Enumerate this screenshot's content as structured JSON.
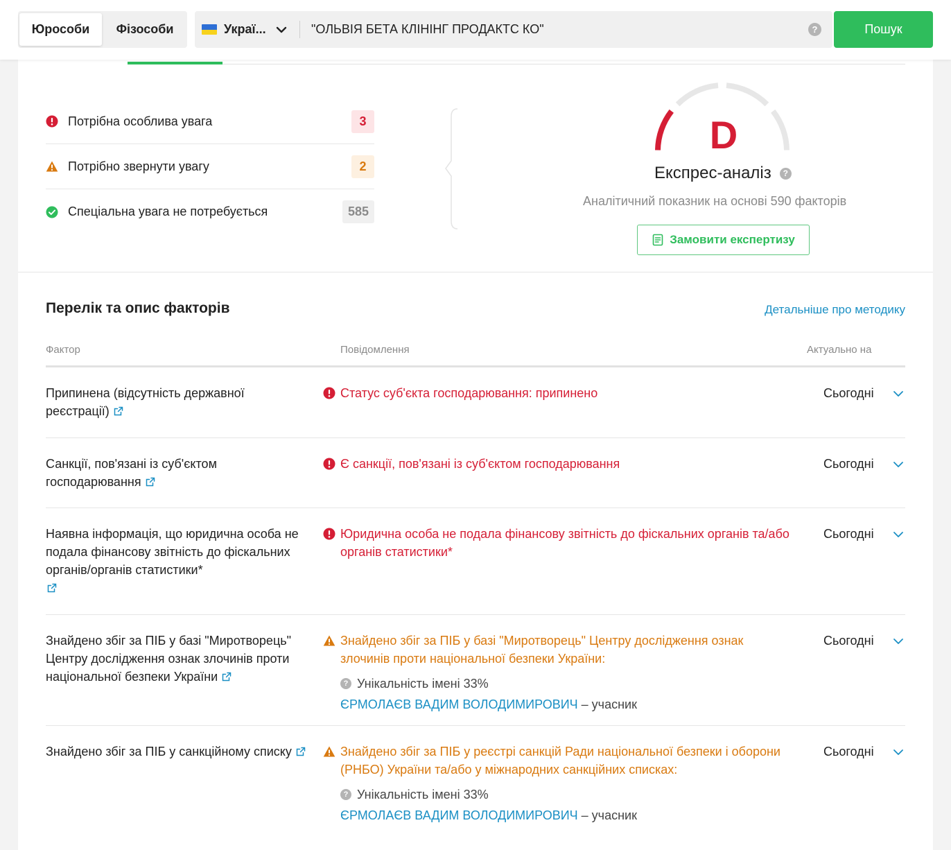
{
  "topbar": {
    "tabs": [
      "Юрособи",
      "Фізособи"
    ],
    "country": "Украї...",
    "query": "\"ОЛЬВІЯ БЕТА КЛІНІНГ ПРОДАКТС КО\"",
    "help": "?",
    "search_label": "Пошук"
  },
  "summary": {
    "items": [
      {
        "label": "Потрібна особлива увага",
        "count": "3",
        "status": "critical"
      },
      {
        "label": "Потрібно звернути увагу",
        "count": "2",
        "status": "warning"
      },
      {
        "label": "Спеціальна увага не потребується",
        "count": "585",
        "status": "ok"
      }
    ]
  },
  "express": {
    "grade": "D",
    "title": "Експрес-аналіз",
    "help": "?",
    "subtitle": "Аналітичний показник на основі 590 факторів",
    "order_label": "Замовити експертизу"
  },
  "factors": {
    "title": "Перелік та опис факторів",
    "method_link": "Детальніше про методику",
    "columns": [
      "Фактор",
      "Повідомлення",
      "Актуально на"
    ],
    "rows": [
      {
        "factor": "Припинена (відсутність державної реєстрації)",
        "message": "Статус суб'єкта господарювання: припинено",
        "severity": "critical",
        "date": "Сьогодні"
      },
      {
        "factor": "Санкції, пов'язані із суб'єктом господарювання",
        "message": "Є санкції, пов'язані із суб'єктом господарювання",
        "severity": "critical",
        "date": "Сьогодні"
      },
      {
        "factor": "Наявна інформація, що юридична особа не подала фінансову звітність до фіскальних органів/органів статистики*",
        "message": "Юридична особа не подала фінансову звітність до фіскальних органів та/або органів статистики*",
        "severity": "critical",
        "date": "Сьогодні"
      },
      {
        "factor": "Знайдено збіг за ПІБ у базі \"Миротворець\" Центру дослідження ознак злочинів проти національної безпеки України",
        "message": "Знайдено збіг за ПІБ у базі \"Миротворець\" Центру дослідження ознак злочинів проти національної безпеки України:",
        "severity": "warning",
        "uniqueness": "Унікальність імені 33%",
        "person": "ЄРМОЛАЄВ ВАДИМ ВОЛОДИМИРОВИЧ",
        "role": " – учасник",
        "date": "Сьогодні"
      },
      {
        "factor": "Знайдено збіг за ПІБ у санкційному списку",
        "message": "Знайдено збіг за ПІБ у реєстрі санкцій Ради національної безпеки і оборони (РНБО) України та/або у міжнародних санкційних списках:",
        "severity": "warning",
        "uniqueness": "Унікальність імені 33%",
        "person": "ЄРМОЛАЄВ ВАДИМ ВОЛОДИМИРОВИЧ",
        "role": " – учасник",
        "date": "Сьогодні"
      }
    ]
  },
  "colors": {
    "green": "#2fbd5c",
    "red": "#d51e35",
    "orange": "#d97a10",
    "link": "#1a8fc4"
  }
}
